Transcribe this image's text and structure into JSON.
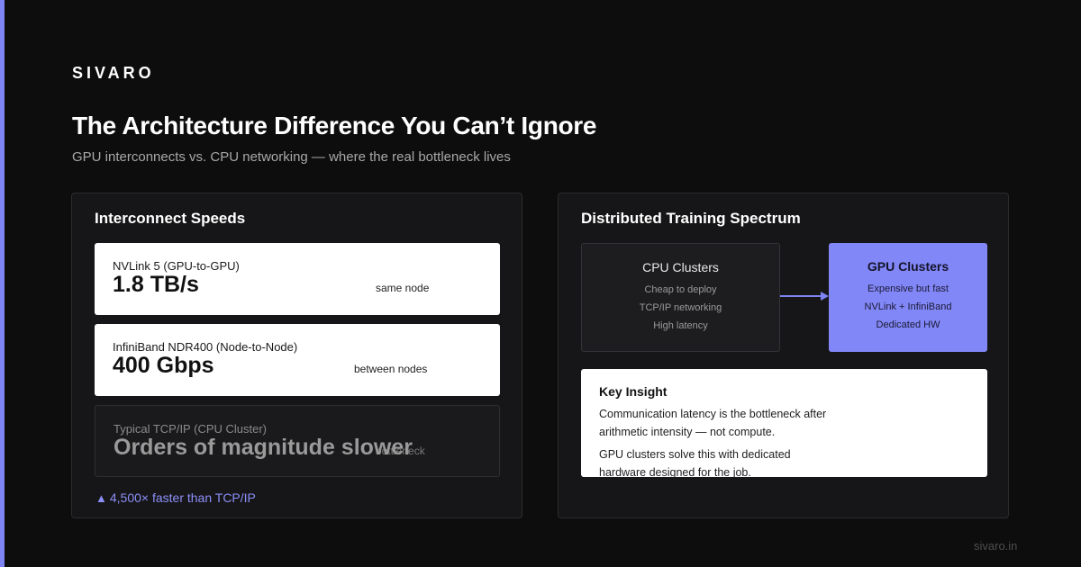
{
  "brand": "SIVARO",
  "title": "The Architecture Difference You Can’t Ignore",
  "subtitle": "GPU interconnects vs. CPU networking — where the real bottleneck lives",
  "left_panel": {
    "title": "Interconnect Speeds",
    "cards": [
      {
        "label": "NVLink 5 (GPU-to-GPU)",
        "value": "1.8 TB/s",
        "note": "same node"
      },
      {
        "label": "InfiniBand NDR400 (Node-to-Node)",
        "value": "400 Gbps",
        "note": "between nodes"
      },
      {
        "label": "Typical TCP/IP (CPU Cluster)",
        "value": "Orders of magnitude slower",
        "note": "bottleneck"
      }
    ],
    "faster_text": "4,500× faster than TCP/IP"
  },
  "right_panel": {
    "title": "Distributed Training Spectrum",
    "cpu": {
      "title": "CPU Clusters",
      "lines": [
        "Cheap to deploy",
        "TCP/IP networking",
        "High latency"
      ]
    },
    "gpu": {
      "title": "GPU Clusters",
      "lines": [
        "Expensive but fast",
        "NVLink + InfiniBand",
        "Dedicated HW"
      ]
    },
    "insight": {
      "title": "Key Insight",
      "para1": "Communication latency is the bottleneck after arithmetic intensity — not compute.",
      "para2": "GPU clusters solve this with dedicated hardware designed for the job."
    }
  },
  "footer": "sivaro.in",
  "colors": {
    "accent": "#7f84f5",
    "background": "#0d0d0d",
    "panel": "#161618"
  }
}
